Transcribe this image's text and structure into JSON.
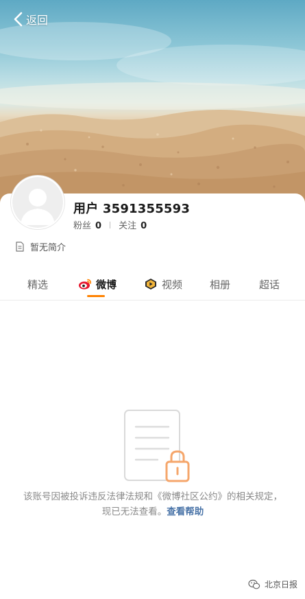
{
  "header": {
    "back_label": "返回",
    "back_icon": "chevron-left-icon"
  },
  "profile": {
    "username": "用户 3591355593",
    "followers_label": "粉丝",
    "followers_count": "0",
    "following_label": "关注",
    "following_count": "0",
    "bio": "暂无简介"
  },
  "tabs": [
    {
      "label": "精选",
      "icon": ""
    },
    {
      "label": "微博",
      "icon": "weibo-logo-icon",
      "active": true
    },
    {
      "label": "视频",
      "icon": "video-icon"
    },
    {
      "label": "相册",
      "icon": ""
    },
    {
      "label": "超话",
      "icon": ""
    }
  ],
  "empty_state": {
    "message": "该账号因被投诉违反法律法规和《微博社区公约》的相关规定，现已无法查看。",
    "help_link": "查看帮助"
  },
  "watermark": {
    "text": "北京日报"
  },
  "colors": {
    "accent": "#ff8200",
    "link": "#4a74a8",
    "lock": "#f5a66b"
  }
}
